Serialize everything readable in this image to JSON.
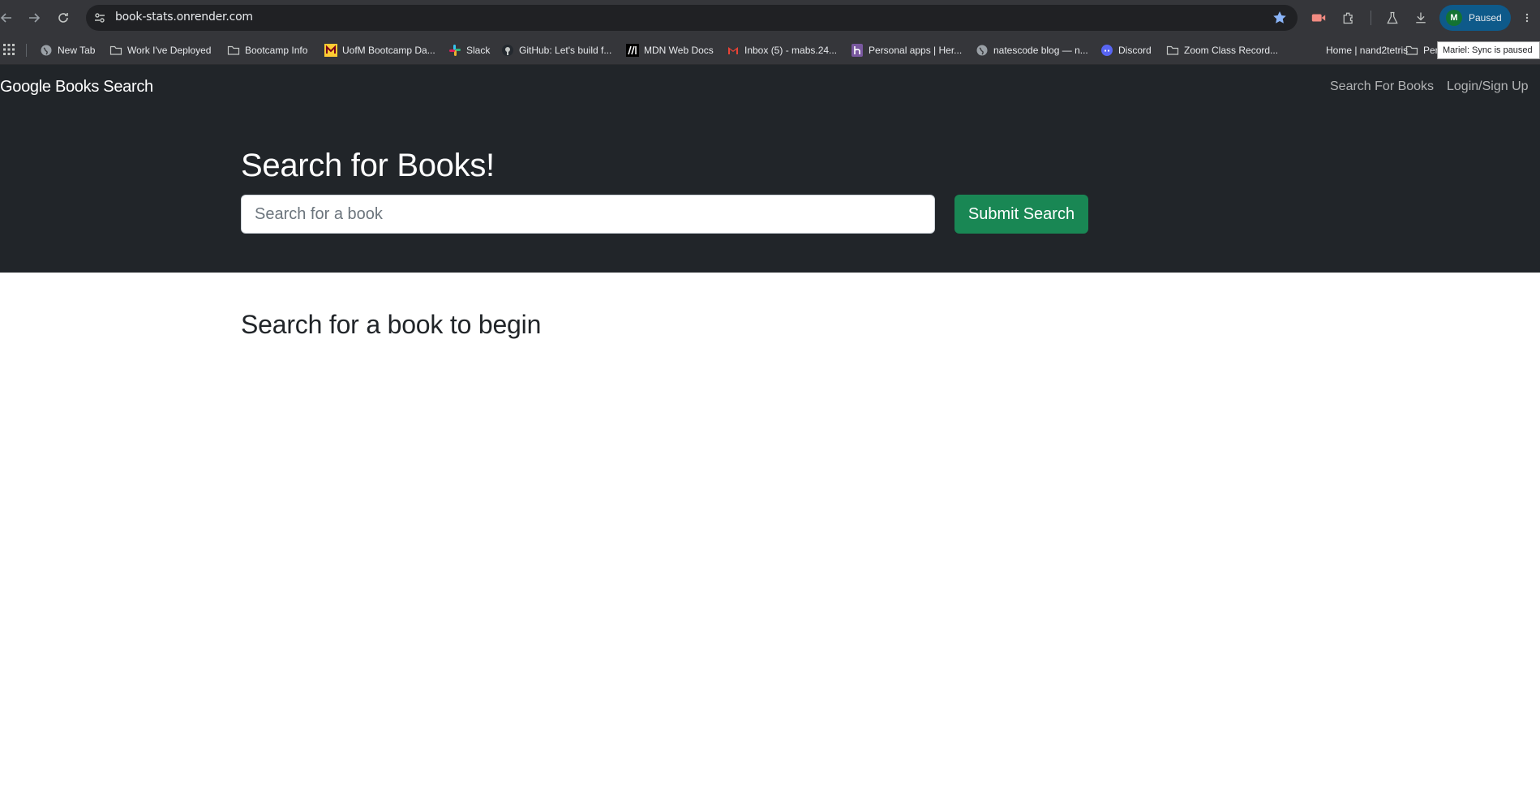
{
  "browser": {
    "url": "book-stats.onrender.com",
    "profile": {
      "initial": "M",
      "status": "Paused"
    },
    "tooltip": "Mariel: Sync is paused",
    "accent": "#8ab4f8"
  },
  "bookmarks": [
    {
      "label": "New Tab",
      "icon": "globe-icon"
    },
    {
      "label": "Work I've Deployed",
      "icon": "folder-icon"
    },
    {
      "label": "Bootcamp Info",
      "icon": "folder-icon"
    },
    {
      "label": "UofM Bootcamp Da...",
      "icon": "uofm-icon"
    },
    {
      "label": "Slack",
      "icon": "slack-icon"
    },
    {
      "label": "GitHub: Let's build f...",
      "icon": "github-icon"
    },
    {
      "label": "MDN Web Docs",
      "icon": "mdn-icon"
    },
    {
      "label": "Inbox (5) - mabs.24...",
      "icon": "gmail-icon"
    },
    {
      "label": "Personal apps | Her...",
      "icon": "heroku-icon"
    },
    {
      "label": "natescode blog — n...",
      "icon": "globe-icon"
    },
    {
      "label": "Discord",
      "icon": "discord-icon"
    },
    {
      "label": "Zoom Class Record...",
      "icon": "folder-icon"
    },
    {
      "label": "Home | nand2tetris",
      "icon": "blank-icon"
    },
    {
      "label": "Per",
      "icon": "folder-icon"
    }
  ],
  "site": {
    "brand": "Google Books Search",
    "nav": [
      "Search For Books",
      "Login/Sign Up"
    ],
    "hero_title": "Search for Books!",
    "search_placeholder": "Search for a book",
    "submit_label": "Submit Search",
    "results_heading": "Search for a book to begin",
    "colors": {
      "dark": "#212529",
      "success": "#198754"
    }
  }
}
